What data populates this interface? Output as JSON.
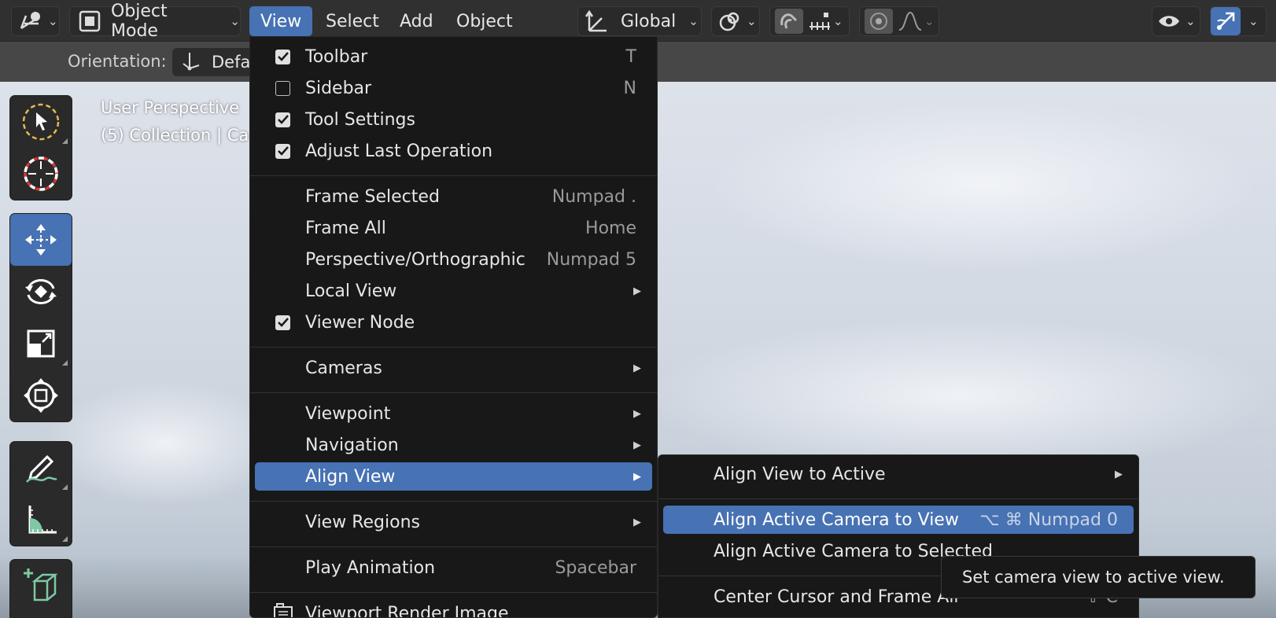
{
  "header": {
    "mode_label": "Object Mode",
    "menus": [
      "View",
      "Select",
      "Add",
      "Object"
    ],
    "orientation_label": "Global"
  },
  "tool_settings": {
    "orientation_label": "Orientation:",
    "orientation_value": "Defa"
  },
  "viewport": {
    "perspective_text": "User Perspective",
    "collection_text": "(5) Collection | Ca"
  },
  "view_menu": {
    "items": [
      {
        "label": "Toolbar",
        "shortcut": "T",
        "checked": true
      },
      {
        "label": "Sidebar",
        "shortcut": "N",
        "checked": false
      },
      {
        "label": "Tool Settings",
        "shortcut": "",
        "checked": true
      },
      {
        "label": "Adjust Last Operation",
        "shortcut": "",
        "checked": true
      },
      {
        "label": "Frame Selected",
        "shortcut": "Numpad ."
      },
      {
        "label": "Frame All",
        "shortcut": "Home"
      },
      {
        "label": "Perspective/Orthographic",
        "shortcut": "Numpad 5"
      },
      {
        "label": "Local View",
        "submenu": true
      },
      {
        "label": "Viewer Node",
        "checked": true
      },
      {
        "label": "Cameras",
        "submenu": true
      },
      {
        "label": "Viewpoint",
        "submenu": true
      },
      {
        "label": "Navigation",
        "submenu": true
      },
      {
        "label": "Align View",
        "submenu": true,
        "highlighted": true
      },
      {
        "label": "View Regions",
        "submenu": true
      },
      {
        "label": "Play Animation",
        "shortcut": "Spacebar"
      },
      {
        "label": "Viewport Render Image"
      }
    ]
  },
  "align_menu": {
    "items": [
      {
        "label": "Align View to Active",
        "submenu": true
      },
      {
        "label": "Align Active Camera to View",
        "shortcut": "⌥ ⌘ Numpad 0",
        "highlighted": true
      },
      {
        "label": "Align Active Camera to Selected"
      },
      {
        "label": "Center Cursor and Frame All",
        "shortcut": "⇧ C"
      }
    ]
  },
  "tooltip": {
    "text": "Set camera view to active view."
  },
  "colors": {
    "accent": "#4772b3",
    "menu_bg": "#181818",
    "header_bg": "#303030"
  }
}
